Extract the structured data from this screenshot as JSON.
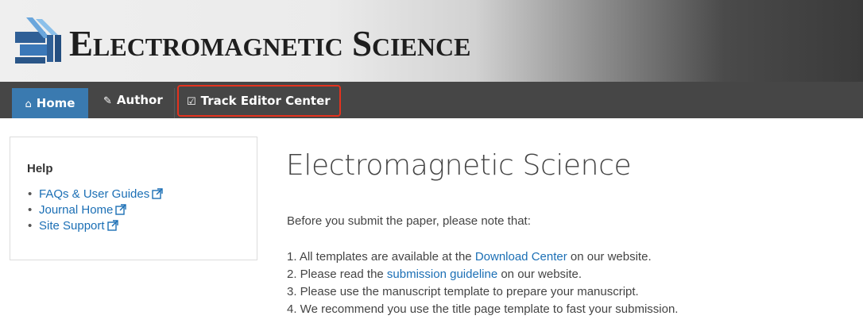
{
  "header": {
    "site_title": "Electromagnetic Science",
    "logo_icon": "journal-logo-icon"
  },
  "nav": {
    "home": {
      "icon": "home-icon",
      "glyph": "⌂",
      "label": "Home"
    },
    "author": {
      "icon": "pencil-icon",
      "glyph": "✎",
      "label": "Author"
    },
    "track": {
      "icon": "checkbox-icon",
      "glyph": "☑",
      "label": "Track Editor Center"
    }
  },
  "colors": {
    "nav_background": "#464646",
    "nav_active": "#3a7ab0",
    "highlight_border": "#e4321e",
    "link": "#1b6fb5"
  },
  "help": {
    "title": "Help",
    "items": [
      {
        "label": "FAQs & User Guides",
        "icon": "external-link-icon"
      },
      {
        "label": "Journal Home",
        "icon": "external-link-icon"
      },
      {
        "label": "Site Support",
        "icon": "external-link-icon"
      }
    ]
  },
  "main": {
    "heading": "Electromagnetic Science",
    "intro": "Before you submit the paper, please note that:",
    "notes": [
      {
        "prefix": "1. All templates are available at the ",
        "link": "Download Center",
        "suffix": " on our website."
      },
      {
        "prefix": "2. Please read the ",
        "link": "submission guideline",
        "suffix": " on our website."
      },
      {
        "prefix": "3. Please use the manuscript template to prepare your manuscript.",
        "link": "",
        "suffix": ""
      },
      {
        "prefix": "4. We recommend you use the title page template to fast your submission.",
        "link": "",
        "suffix": ""
      }
    ]
  }
}
